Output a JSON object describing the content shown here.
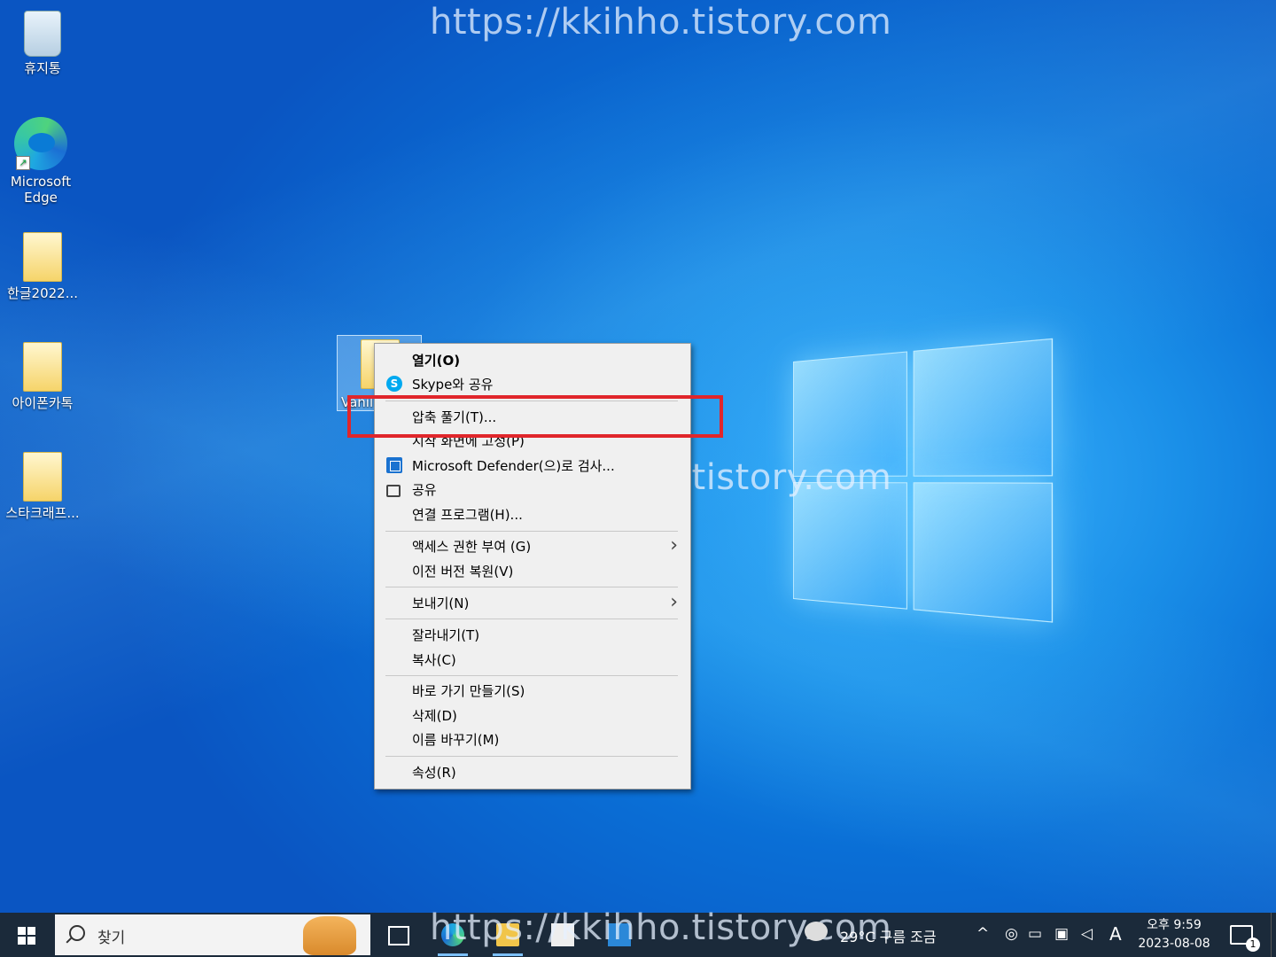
{
  "watermark": "https://kkihho.tistory.com",
  "desktop": {
    "icons": [
      {
        "label": "휴지통"
      },
      {
        "label": "Microsoft Edge"
      },
      {
        "label": "한글2022..."
      },
      {
        "label": "아이폰카톡"
      },
      {
        "label": "스타크래프..."
      }
    ],
    "selected_file_label": "Vanil"
  },
  "context_menu": {
    "items": [
      {
        "label": "열기(O)",
        "icon": "none"
      },
      {
        "label": "Skype와 공유",
        "icon": "skype-icon"
      },
      {
        "label": "압축 풀기(T)...",
        "icon": "none"
      },
      {
        "label": "시작 화면에 고정(P)",
        "icon": "none"
      },
      {
        "label": "Microsoft Defender(으)로 검사...",
        "icon": "defender-icon"
      },
      {
        "label": "공유",
        "icon": "share-icon"
      },
      {
        "label": "연결 프로그램(H)...",
        "icon": "none"
      },
      {
        "label": "액세스 권한 부여 (G)",
        "icon": "none",
        "submenu": true
      },
      {
        "label": "이전 버전 복원(V)",
        "icon": "none"
      },
      {
        "label": "보내기(N)",
        "icon": "none",
        "submenu": true
      },
      {
        "label": "잘라내기(T)",
        "icon": "none"
      },
      {
        "label": "복사(C)",
        "icon": "none"
      },
      {
        "label": "바로 가기 만들기(S)",
        "icon": "none"
      },
      {
        "label": "삭제(D)",
        "icon": "none"
      },
      {
        "label": "이름 바꾸기(M)",
        "icon": "none"
      },
      {
        "label": "속성(R)",
        "icon": "none"
      }
    ],
    "submenu_arrow": "›",
    "highlight_color": "#e0262b"
  },
  "taskbar": {
    "search_placeholder": "찾기",
    "weather": "29°C 구름 조금",
    "ime": "A",
    "time": "오후 9:59",
    "date": "2023-08-08",
    "notification_count": "1",
    "tray_chevron": "^"
  }
}
